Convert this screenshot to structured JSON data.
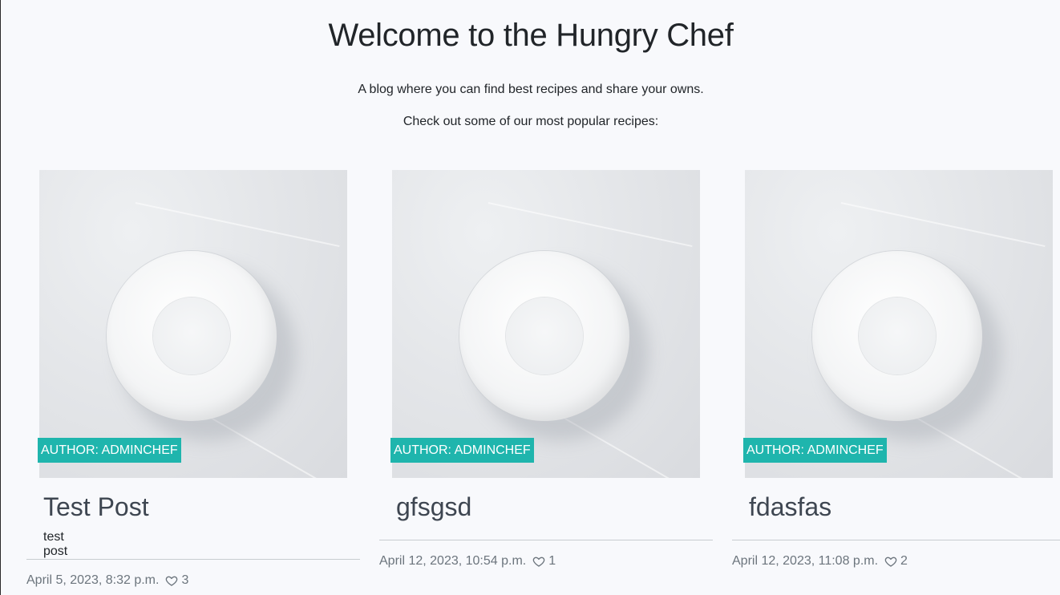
{
  "hero": {
    "title": "Welcome to the Hungry Chef",
    "tagline": "A blog where you can find best recipes and share your owns.",
    "popular_intro": "Check out some of our most popular recipes:"
  },
  "posts": [
    {
      "author": "Author: adminchef",
      "title": "Test Post",
      "excerpt": "test post",
      "date": "April 5, 2023, 8:32 p.m.",
      "likes": "3",
      "image_icon": "white-bowl-image"
    },
    {
      "author": "Author: adminchef",
      "title": "gfsgsd",
      "excerpt": "",
      "date": "April 12, 2023, 10:54 p.m.",
      "likes": "1",
      "image_icon": "white-bowl-image"
    },
    {
      "author": "Author: adminchef",
      "title": "fdasfas",
      "excerpt": "",
      "date": "April 12, 2023, 11:08 p.m.",
      "likes": "2",
      "image_icon": "white-bowl-image"
    }
  ],
  "colors": {
    "background": "#f8f9fc",
    "author_badge": "#1fb5ad",
    "title_text": "#3e4651",
    "meta_text": "#6c757d"
  },
  "icons": {
    "likes": "heart-outline-icon"
  }
}
